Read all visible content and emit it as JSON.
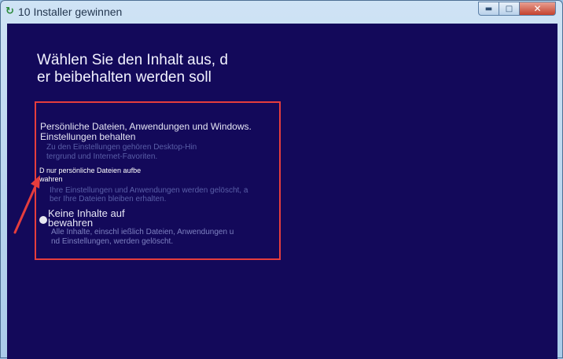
{
  "window": {
    "title": "10 Installer gewinnen",
    "buttons": {
      "minimize": "▬",
      "maximize": "□",
      "close": "✕"
    }
  },
  "heading": {
    "line1": "Wählen Sie den Inhalt aus, d",
    "line2": "er beibehalten werden soll"
  },
  "options": [
    {
      "label_lines": [
        "Persönliche Dateien, Anwendungen und Windows.",
        "Einstellungen behalten"
      ],
      "desc_lines": [
        "Zu den Einstellungen gehören Desktop-Hin",
        "tergrund und Internet-Favoriten."
      ]
    },
    {
      "label_lines": [
        "D nur persönliche Dateien aufbe",
        "wahren"
      ],
      "desc_lines": [
        "Ihre Einstellungen und Anwendungen werden gelöscht, a",
        "ber Ihre Dateien bleiben erhalten."
      ]
    },
    {
      "label_lines": [
        "Keine Inhalte auf",
        "bewahren"
      ],
      "desc_lines": [
        "Alle Inhalte, einschl ießlich Dateien, Anwendungen u",
        "nd Einstellungen, werden gelöscht."
      ]
    }
  ],
  "colors": {
    "background": "#13095a",
    "highlight": "#e53d3d",
    "annotation_arrow": "#e53d3d"
  },
  "icons": {
    "app": "installer-icon",
    "radio": "radio-button-icon",
    "annotation": "red-arrow-icon"
  }
}
